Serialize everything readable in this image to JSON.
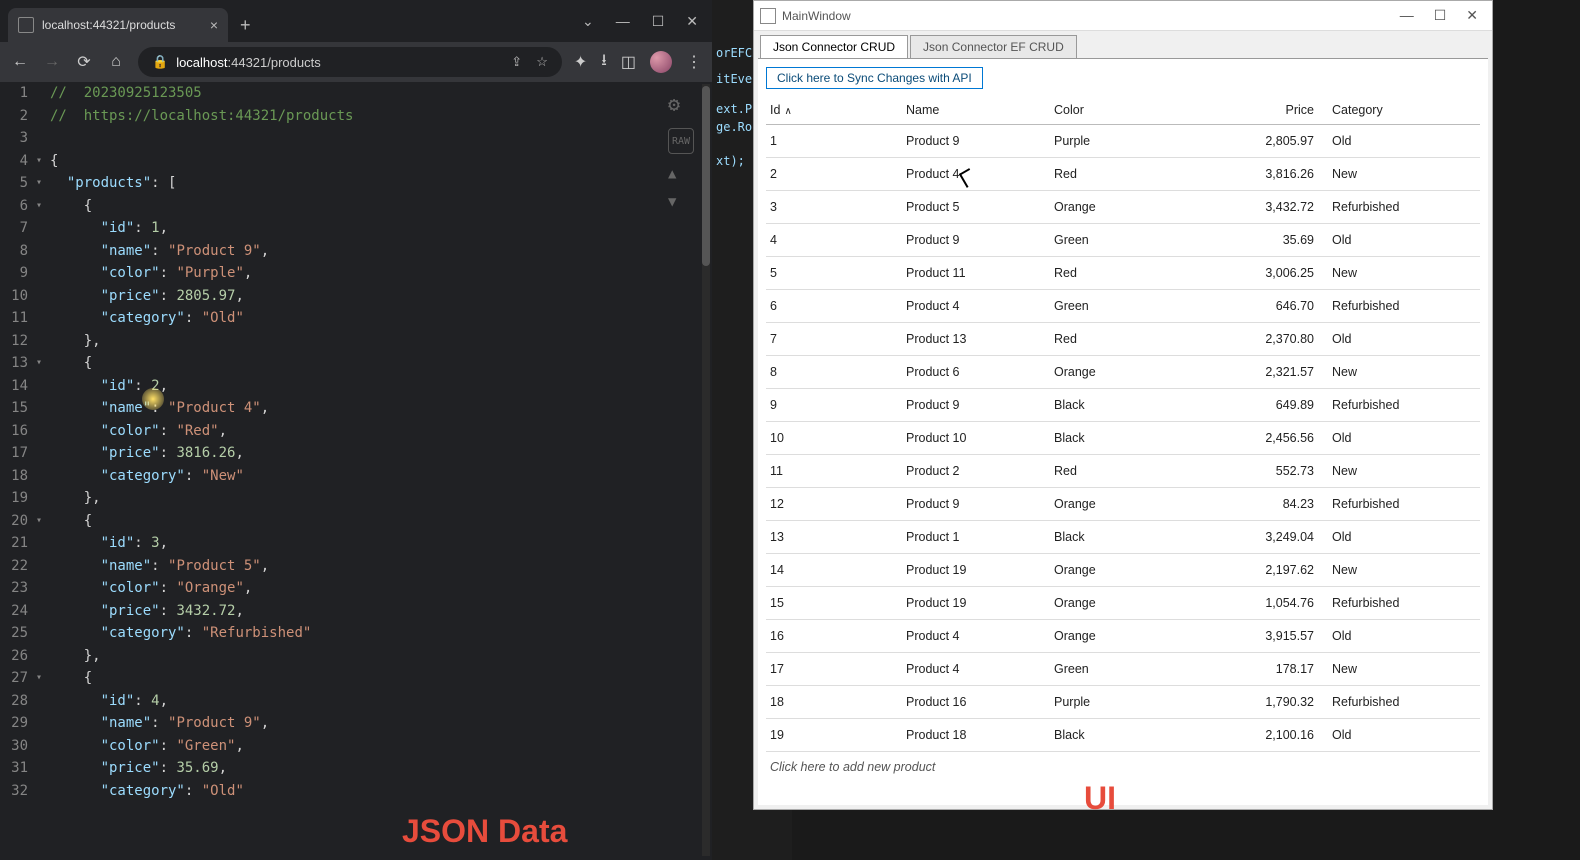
{
  "browser": {
    "tab_title": "localhost:44321/products",
    "url_host": "localhost",
    "url_port_path": ":44321/products",
    "comment_ts": "20230925123505",
    "comment_url": "https://localhost:44321/products"
  },
  "code_lines": [
    {
      "n": 1,
      "fold": "",
      "html": "<span class='c-comment'>//  20230925123505</span>"
    },
    {
      "n": 2,
      "fold": "",
      "html": "<span class='c-comment'>//  https://localhost:44321/products</span>"
    },
    {
      "n": 3,
      "fold": "",
      "html": ""
    },
    {
      "n": 4,
      "fold": "▾",
      "html": "<span class='c-pun'>{</span>"
    },
    {
      "n": 5,
      "fold": "▾",
      "html": "  <span class='c-key'>\"products\"</span><span class='c-pun'>: [</span>"
    },
    {
      "n": 6,
      "fold": "▾",
      "html": "    <span class='c-pun'>{</span>"
    },
    {
      "n": 7,
      "fold": "",
      "html": "      <span class='c-key'>\"id\"</span><span class='c-pun'>: </span><span class='c-num'>1</span><span class='c-pun'>,</span>"
    },
    {
      "n": 8,
      "fold": "",
      "html": "      <span class='c-key'>\"name\"</span><span class='c-pun'>: </span><span class='c-str'>\"Product 9\"</span><span class='c-pun'>,</span>"
    },
    {
      "n": 9,
      "fold": "",
      "html": "      <span class='c-key'>\"color\"</span><span class='c-pun'>: </span><span class='c-str'>\"Purple\"</span><span class='c-pun'>,</span>"
    },
    {
      "n": 10,
      "fold": "",
      "html": "      <span class='c-key'>\"price\"</span><span class='c-pun'>: </span><span class='c-num'>2805.97</span><span class='c-pun'>,</span>"
    },
    {
      "n": 11,
      "fold": "",
      "html": "      <span class='c-key'>\"category\"</span><span class='c-pun'>: </span><span class='c-str'>\"Old\"</span>"
    },
    {
      "n": 12,
      "fold": "",
      "html": "    <span class='c-pun'>},</span>"
    },
    {
      "n": 13,
      "fold": "▾",
      "html": "    <span class='c-pun'>{</span>"
    },
    {
      "n": 14,
      "fold": "",
      "html": "      <span class='c-key'>\"id\"</span><span class='c-pun'>: </span><span class='c-num'>2</span><span class='c-pun'>,</span>"
    },
    {
      "n": 15,
      "fold": "",
      "html": "      <span class='c-key'>\"name\"</span><span class='c-pun'>: </span><span class='c-str'>\"Product 4\"</span><span class='c-pun'>,</span>"
    },
    {
      "n": 16,
      "fold": "",
      "html": "      <span class='c-key'>\"color\"</span><span class='c-pun'>: </span><span class='c-str'>\"Red\"</span><span class='c-pun'>,</span>"
    },
    {
      "n": 17,
      "fold": "",
      "html": "      <span class='c-key'>\"price\"</span><span class='c-pun'>: </span><span class='c-num'>3816.26</span><span class='c-pun'>,</span>"
    },
    {
      "n": 18,
      "fold": "",
      "html": "      <span class='c-key'>\"category\"</span><span class='c-pun'>: </span><span class='c-str'>\"New\"</span>"
    },
    {
      "n": 19,
      "fold": "",
      "html": "    <span class='c-pun'>},</span>"
    },
    {
      "n": 20,
      "fold": "▾",
      "html": "    <span class='c-pun'>{</span>"
    },
    {
      "n": 21,
      "fold": "",
      "html": "      <span class='c-key'>\"id\"</span><span class='c-pun'>: </span><span class='c-num'>3</span><span class='c-pun'>,</span>"
    },
    {
      "n": 22,
      "fold": "",
      "html": "      <span class='c-key'>\"name\"</span><span class='c-pun'>: </span><span class='c-str'>\"Product 5\"</span><span class='c-pun'>,</span>"
    },
    {
      "n": 23,
      "fold": "",
      "html": "      <span class='c-key'>\"color\"</span><span class='c-pun'>: </span><span class='c-str'>\"Orange\"</span><span class='c-pun'>,</span>"
    },
    {
      "n": 24,
      "fold": "",
      "html": "      <span class='c-key'>\"price\"</span><span class='c-pun'>: </span><span class='c-num'>3432.72</span><span class='c-pun'>,</span>"
    },
    {
      "n": 25,
      "fold": "",
      "html": "      <span class='c-key'>\"category\"</span><span class='c-pun'>: </span><span class='c-str'>\"Refurbished\"</span>"
    },
    {
      "n": 26,
      "fold": "",
      "html": "    <span class='c-pun'>},</span>"
    },
    {
      "n": 27,
      "fold": "▾",
      "html": "    <span class='c-pun'>{</span>"
    },
    {
      "n": 28,
      "fold": "",
      "html": "      <span class='c-key'>\"id\"</span><span class='c-pun'>: </span><span class='c-num'>4</span><span class='c-pun'>,</span>"
    },
    {
      "n": 29,
      "fold": "",
      "html": "      <span class='c-key'>\"name\"</span><span class='c-pun'>: </span><span class='c-str'>\"Product 9\"</span><span class='c-pun'>,</span>"
    },
    {
      "n": 30,
      "fold": "",
      "html": "      <span class='c-key'>\"color\"</span><span class='c-pun'>: </span><span class='c-str'>\"Green\"</span><span class='c-pun'>,</span>"
    },
    {
      "n": 31,
      "fold": "",
      "html": "      <span class='c-key'>\"price\"</span><span class='c-pun'>: </span><span class='c-num'>35.69</span><span class='c-pun'>,</span>"
    },
    {
      "n": 32,
      "fold": "",
      "html": "      <span class='c-key'>\"category\"</span><span class='c-pun'>: </span><span class='c-str'>\"Old\"</span>"
    }
  ],
  "bg_fragments": [
    "orEFCRU",
    "",
    "",
    "itEve",
    "",
    "",
    "",
    "ext.P",
    "ge.Ro",
    "",
    "",
    "",
    "",
    "xt);"
  ],
  "winapp": {
    "title": "MainWindow",
    "tabs": [
      "Json Connector CRUD",
      "Json Connector EF CRUD"
    ],
    "active_tab": 0,
    "sync_button": "Click here to Sync Changes with API",
    "columns": [
      "Id",
      "Name",
      "Color",
      "Price",
      "Category"
    ],
    "sort_column": "Id",
    "sort_dir": "asc",
    "rows": [
      {
        "id": "1",
        "name": "Product 9",
        "color": "Purple",
        "price": "2,805.97",
        "category": "Old"
      },
      {
        "id": "2",
        "name": "Product 4",
        "color": "Red",
        "price": "3,816.26",
        "category": "New"
      },
      {
        "id": "3",
        "name": "Product 5",
        "color": "Orange",
        "price": "3,432.72",
        "category": "Refurbished"
      },
      {
        "id": "4",
        "name": "Product 9",
        "color": "Green",
        "price": "35.69",
        "category": "Old"
      },
      {
        "id": "5",
        "name": "Product 11",
        "color": "Red",
        "price": "3,006.25",
        "category": "New"
      },
      {
        "id": "6",
        "name": "Product 4",
        "color": "Green",
        "price": "646.70",
        "category": "Refurbished"
      },
      {
        "id": "7",
        "name": "Product 13",
        "color": "Red",
        "price": "2,370.80",
        "category": "Old"
      },
      {
        "id": "8",
        "name": "Product 6",
        "color": "Orange",
        "price": "2,321.57",
        "category": "New"
      },
      {
        "id": "9",
        "name": "Product 9",
        "color": "Black",
        "price": "649.89",
        "category": "Refurbished"
      },
      {
        "id": "10",
        "name": "Product 10",
        "color": "Black",
        "price": "2,456.56",
        "category": "Old"
      },
      {
        "id": "11",
        "name": "Product 2",
        "color": "Red",
        "price": "552.73",
        "category": "New"
      },
      {
        "id": "12",
        "name": "Product 9",
        "color": "Orange",
        "price": "84.23",
        "category": "Refurbished"
      },
      {
        "id": "13",
        "name": "Product 1",
        "color": "Black",
        "price": "3,249.04",
        "category": "Old"
      },
      {
        "id": "14",
        "name": "Product 19",
        "color": "Orange",
        "price": "2,197.62",
        "category": "New"
      },
      {
        "id": "15",
        "name": "Product 19",
        "color": "Orange",
        "price": "1,054.76",
        "category": "Refurbished"
      },
      {
        "id": "16",
        "name": "Product 4",
        "color": "Orange",
        "price": "3,915.57",
        "category": "Old"
      },
      {
        "id": "17",
        "name": "Product 4",
        "color": "Green",
        "price": "178.17",
        "category": "New"
      },
      {
        "id": "18",
        "name": "Product 16",
        "color": "Purple",
        "price": "1,790.32",
        "category": "Refurbished"
      },
      {
        "id": "19",
        "name": "Product 18",
        "color": "Black",
        "price": "2,100.16",
        "category": "Old"
      }
    ],
    "add_prompt": "Click here to add new product"
  },
  "labels": {
    "json_data": "JSON Data",
    "ui": "UI"
  }
}
